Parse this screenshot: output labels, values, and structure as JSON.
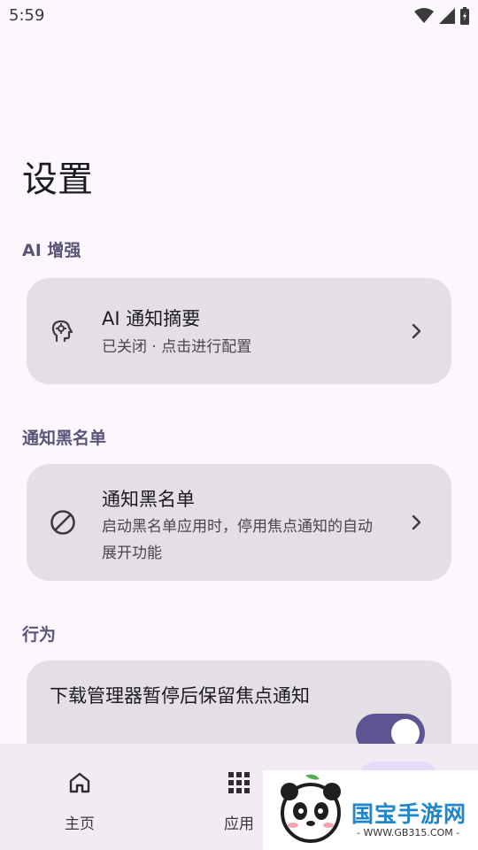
{
  "status_bar": {
    "time": "5:59",
    "icons": [
      "wifi-icon",
      "signal-icon",
      "battery-icon"
    ]
  },
  "page": {
    "title": "设置"
  },
  "sections": [
    {
      "header": "AI 增强",
      "card": {
        "icon": "brain-icon",
        "title": "AI 通知摘要",
        "subtitle": "已关闭 · 点击进行配置"
      }
    },
    {
      "header": "通知黑名单",
      "card": {
        "icon": "block-icon",
        "title": "通知黑名单",
        "subtitle": "启动黑名单应用时，停用焦点通知的自动展开功能"
      }
    },
    {
      "header": "行为",
      "card": {
        "title": "下载管理器暂停后保留焦点通知",
        "toggle_on": true
      }
    }
  ],
  "bottom_nav": {
    "items": [
      {
        "label": "主页",
        "icon": "home-icon"
      },
      {
        "label": "应用",
        "icon": "apps-grid-icon"
      }
    ]
  },
  "watermark": {
    "brand": "国宝手游网",
    "url": "- WWW.GB315.COM -"
  },
  "colors": {
    "accent": "#5e5491",
    "card": "#e4dfe4",
    "background": "#fcf7fc"
  }
}
